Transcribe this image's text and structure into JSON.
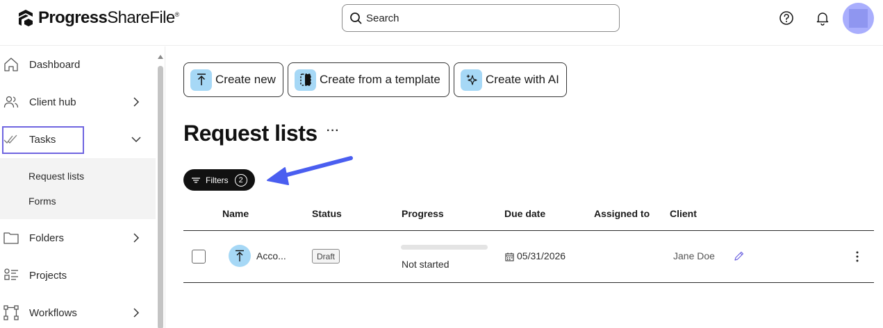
{
  "app": {
    "logo_bold": "Progress",
    "logo_regular": "ShareFile",
    "logo_mark": "®"
  },
  "header": {
    "search_placeholder": "Search",
    "help_icon": "help-icon",
    "bell_icon": "bell-icon",
    "avatar_color": "#a9aefd"
  },
  "sidebar": {
    "items": [
      {
        "label": "Dashboard",
        "icon": "home-icon"
      },
      {
        "label": "Client hub",
        "icon": "people-icon",
        "expandable": true
      },
      {
        "label": "Tasks",
        "icon": "double-check-icon",
        "expanded": true
      },
      {
        "label": "Folders",
        "icon": "folder-icon",
        "expandable": true
      },
      {
        "label": "Projects",
        "icon": "projects-icon"
      },
      {
        "label": "Workflows",
        "icon": "workflow-icon",
        "expandable": true
      }
    ],
    "subitems": [
      "Request lists",
      "Forms"
    ]
  },
  "toolbar": {
    "create_new": "Create new",
    "create_template": "Create from a template",
    "create_ai": "Create with AI"
  },
  "page": {
    "title": "Request lists",
    "more": "···",
    "filters_label": "Filters",
    "filters_count": "2"
  },
  "table": {
    "columns": [
      "Name",
      "Status",
      "Progress",
      "Due date",
      "Assigned to",
      "Client"
    ],
    "rows": [
      {
        "name": "Acco...",
        "status": "Draft",
        "progress_fraction": 0,
        "progress_text": "Not started",
        "due_date": "05/31/2026",
        "assigned_to": "",
        "client": "Jane Doe"
      }
    ]
  },
  "colors": {
    "accent": "#6e64e0",
    "icon_bg": "#a6d8f6",
    "annotation_arrow": "#4a5ef0"
  }
}
